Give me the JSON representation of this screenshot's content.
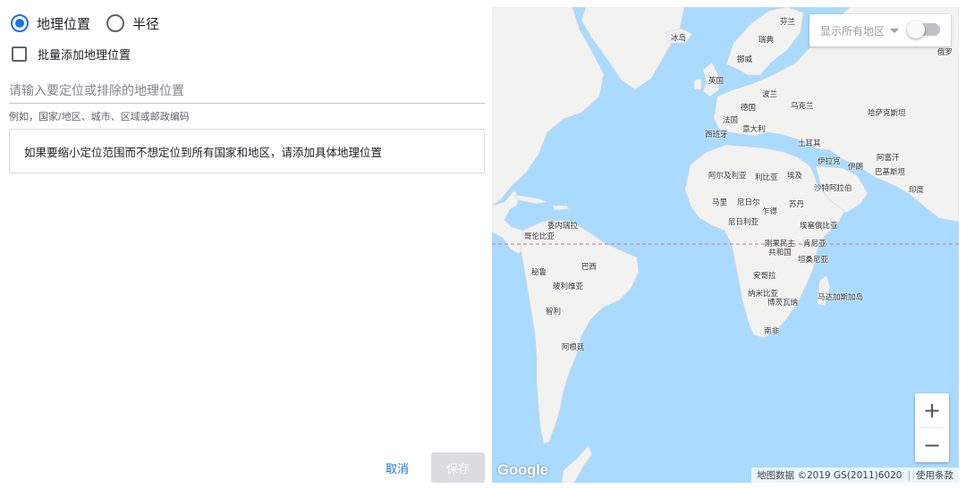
{
  "location_mode": {
    "options": [
      {
        "label": "地理位置",
        "selected": true
      },
      {
        "label": "半径",
        "selected": false
      }
    ]
  },
  "bulk_add": {
    "label": "批量添加地理位置",
    "checked": false
  },
  "search": {
    "placeholder": "请输入要定位或排除的地理位置",
    "value": ""
  },
  "hint": "例如，国家/地区、城市、区域或邮政编码",
  "info_message": "如果要缩小定位范围而不想定位到所有国家和地区，请添加具体地理位置",
  "actions": {
    "cancel": "取消",
    "save": "保存"
  },
  "map": {
    "region_toggle_label": "显示所有地区",
    "region_toggle_on": false,
    "zoom_in": "+",
    "zoom_out": "−",
    "logo": "Google",
    "attribution": "地图数据 ©2019 GS(2011)6020",
    "terms": "使用条款",
    "labels": {
      "finland": "芬兰",
      "sweden": "瑞典",
      "norway": "挪威",
      "iceland": "冰岛",
      "russia": "俄罗",
      "uk": "英国",
      "germany": "德国",
      "poland": "波兰",
      "ukraine": "乌克兰",
      "kazakhstan": "哈萨克斯坦",
      "france": "法国",
      "spain": "西班牙",
      "italy": "意大利",
      "turkey": "土耳其",
      "afghanistan": "阿富汗",
      "iraq": "伊拉克",
      "iran": "伊朗",
      "pakistan": "巴基斯坦",
      "algeria": "阿尔及利亚",
      "libya": "利比亚",
      "egypt": "埃及",
      "saudi": "沙特阿拉伯",
      "india": "印度",
      "mali": "马里",
      "niger": "尼日尔",
      "chad": "乍得",
      "sudan": "苏丹",
      "nigeria": "尼日利亚",
      "ethiopia": "埃塞俄比亚",
      "venezuela": "委内瑞拉",
      "colombia": "哥伦比亚",
      "drc": "刚果民主共和国",
      "kenya": "肯尼亚",
      "tanzania": "坦桑尼亚",
      "brazil": "巴西",
      "peru": "秘鲁",
      "bolivia": "玻利维亚",
      "angola": "安哥拉",
      "namibia": "纳米比亚",
      "botswana": "博茨瓦纳",
      "madagascar": "马达加斯加岛",
      "chile": "智利",
      "south_africa": "南非",
      "argentina": "阿根廷"
    }
  }
}
